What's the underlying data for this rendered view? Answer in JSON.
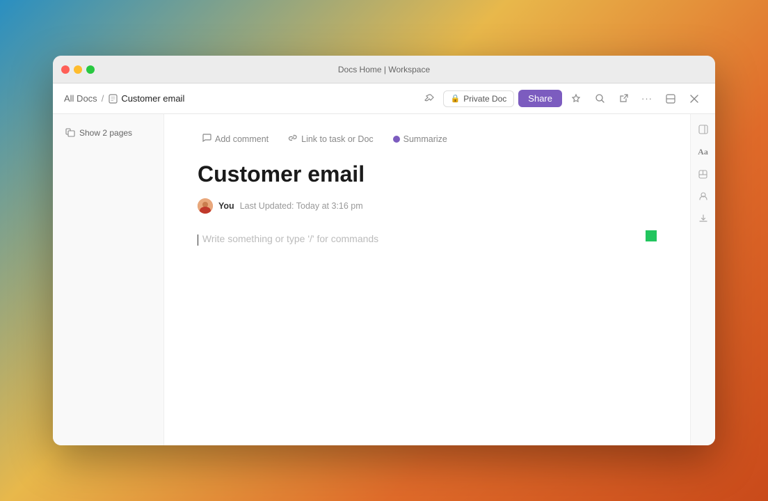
{
  "window": {
    "title": "Docs Home | Workspace"
  },
  "titleBar": {
    "title": "Docs Home | Workspace",
    "trafficLights": {
      "close": "close",
      "minimize": "minimize",
      "maximize": "maximize"
    }
  },
  "toolbar": {
    "breadcrumb": {
      "parent": "All Docs",
      "separator": "/",
      "current": "Customer email"
    },
    "privateDoc": "Private Doc",
    "shareLabel": "Share",
    "moreOptions": "···",
    "icons": {
      "pin": "📌",
      "search": "🔍",
      "export": "↗"
    }
  },
  "sidebar": {
    "showPages": "Show 2 pages"
  },
  "actionBar": {
    "addComment": "Add comment",
    "linkToTask": "Link to task or Doc",
    "summarize": "Summarize"
  },
  "editor": {
    "title": "Customer email",
    "author": "You",
    "lastUpdated": "Last Updated: Today at 3:16 pm",
    "placeholder": "Write something or type '/' for commands"
  },
  "rightSidebar": {
    "icons": {
      "collapse": "⊟",
      "text": "Aa",
      "expand": "⊞",
      "users": "👤",
      "download": "⬇"
    }
  }
}
